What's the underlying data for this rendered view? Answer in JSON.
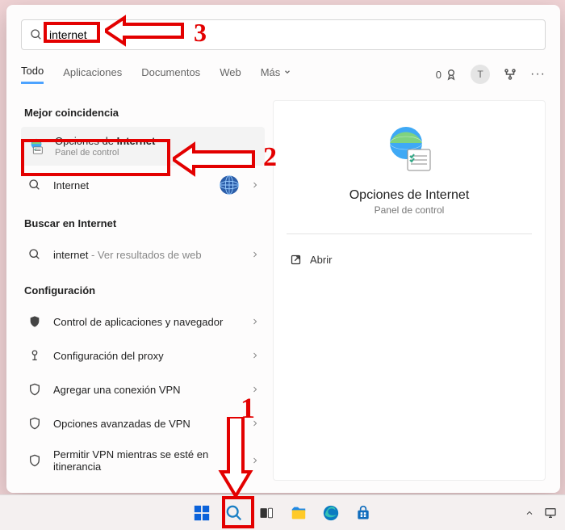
{
  "search": {
    "value": "internet"
  },
  "tabs": {
    "items": [
      "Todo",
      "Aplicaciones",
      "Documentos",
      "Web"
    ],
    "more": "Más",
    "rewards": "0",
    "avatar": "T"
  },
  "left": {
    "best_label": "Mejor coincidencia",
    "best": {
      "title_pre": "Opciones de ",
      "title_bold": "Internet",
      "sub": "Panel de control"
    },
    "internet_item": {
      "title": "Internet"
    },
    "web_label": "Buscar en Internet",
    "web_item": {
      "title": "internet",
      "sub": " - Ver resultados de web"
    },
    "config_label": "Configuración",
    "config": [
      "Control de aplicaciones y navegador",
      "Configuración del proxy",
      "Agregar una conexión VPN",
      "Opciones avanzadas de VPN",
      "Permitir VPN mientras se esté en itinerancia"
    ]
  },
  "preview": {
    "title": "Opciones de Internet",
    "sub": "Panel de control",
    "open": "Abrir"
  },
  "annotations": {
    "n1": "1",
    "n2": "2",
    "n3": "3"
  }
}
